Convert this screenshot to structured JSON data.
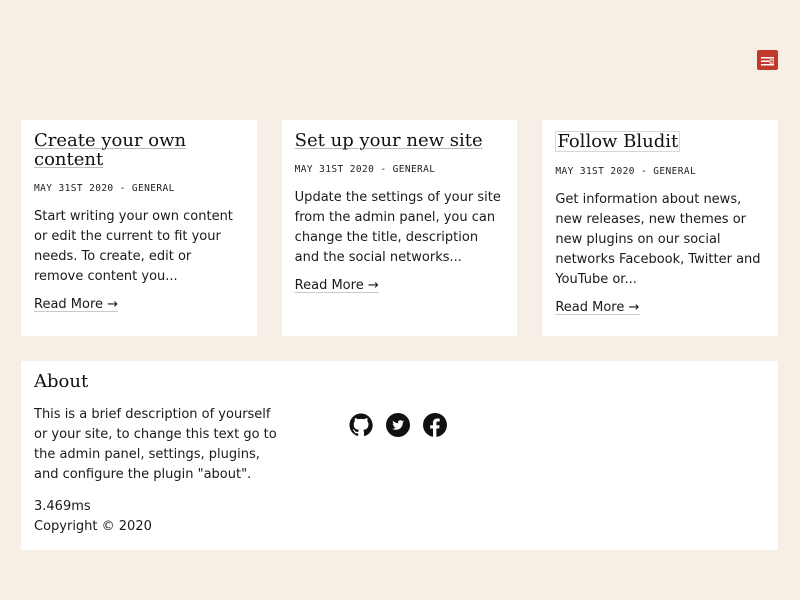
{
  "header": {
    "menu_icon": "menu-icon"
  },
  "posts": [
    {
      "title": "Create your own content",
      "meta": "MAY 31ST 2020 - GENERAL",
      "excerpt": "Start writing your own content or edit the current to fit your needs. To create, edit or remove content you...",
      "link": "Read More →"
    },
    {
      "title": "Set up your new site",
      "meta": "MAY 31ST 2020 - GENERAL",
      "excerpt": "Update the settings of your site from the admin panel, you can change the title, description and the social networks...",
      "link": "Read More →"
    },
    {
      "title": "Follow Bludit",
      "meta": "MAY 31ST 2020 - GENERAL",
      "excerpt": "Get information about news, new releases, new themes or new plugins on our social networks Facebook, Twitter and YouTube or...",
      "link": "Read More →"
    }
  ],
  "about": {
    "title": "About",
    "text": "This is a brief description of yourself or your site, to change this text go to the admin panel, settings, plugins, and configure the plugin \"about\".",
    "timing": "3.469ms",
    "copyright": "Copyright © 2020"
  },
  "social_icons": [
    "github-icon",
    "twitter-icon",
    "facebook-icon"
  ],
  "colors": {
    "background": "#f7efe6",
    "accent": "#c0392b",
    "card": "#ffffff"
  }
}
